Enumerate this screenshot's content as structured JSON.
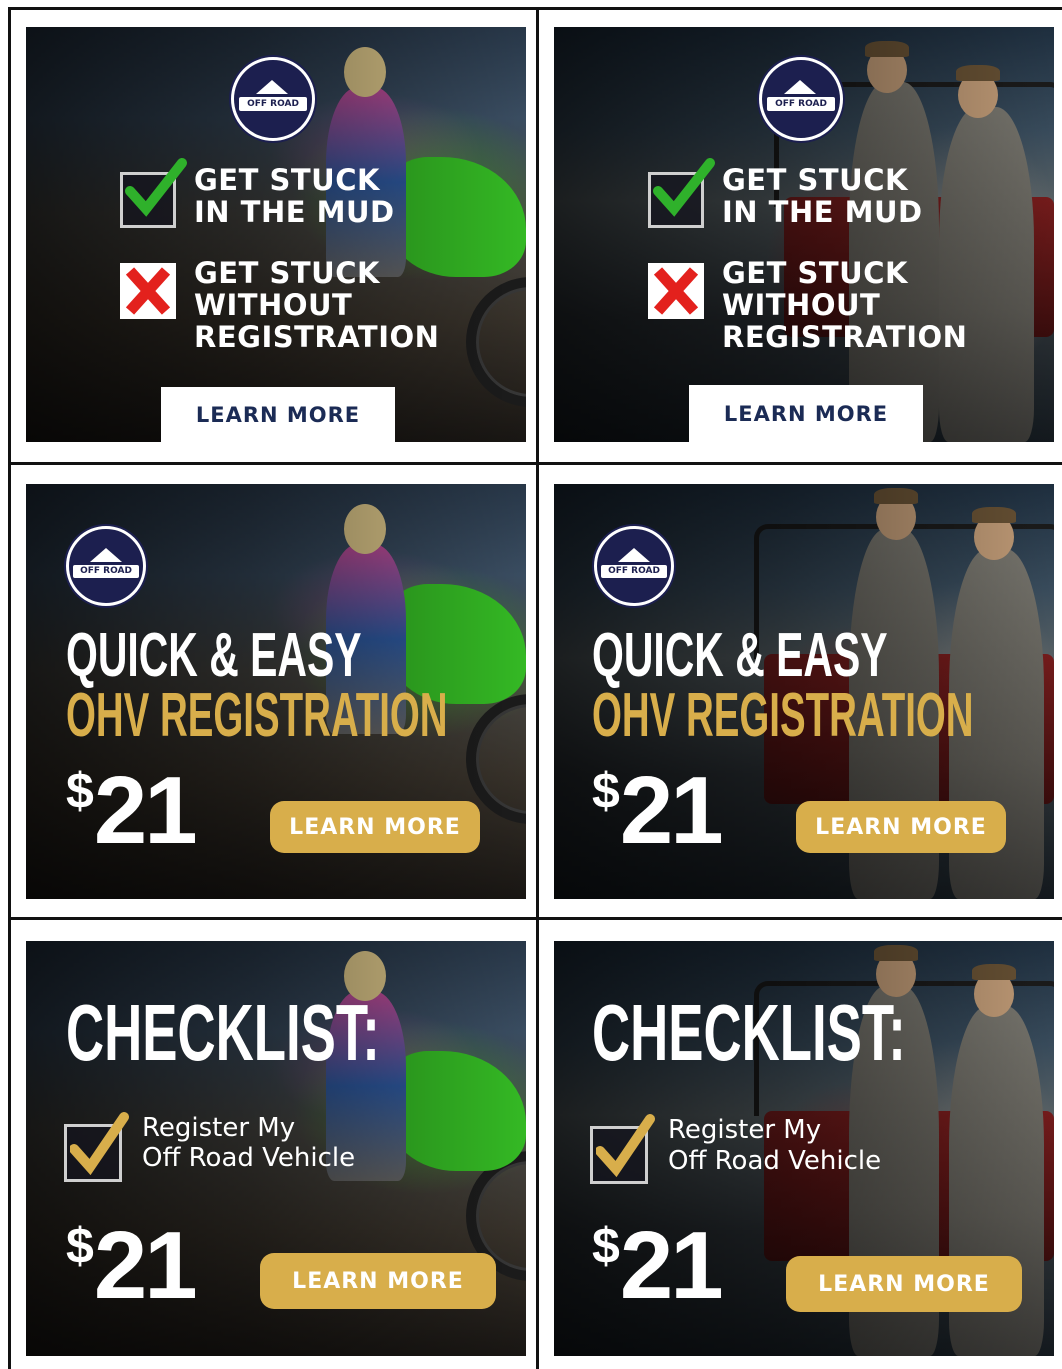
{
  "colors": {
    "gold": "#d8ae4b",
    "navy": "#1b2b55",
    "check_green": "#2fb12b",
    "cross_red": "#e3211d"
  },
  "logo": {
    "text": "OFF ROAD"
  },
  "row1": {
    "check_line1": "GET STUCK",
    "check_line2": "IN THE MUD",
    "cross_line1": "GET STUCK",
    "cross_line2": "WITHOUT",
    "cross_line3": "REGISTRATION",
    "button": "LEARN MORE"
  },
  "row2": {
    "headline1": "QUICK & EASY",
    "headline2": "OHV REGISTRATION",
    "dollar": "$",
    "price": "21",
    "button": "LEARN MORE"
  },
  "row3": {
    "headline": "CHECKLIST:",
    "item_line1": "Register My",
    "item_line2": "Off Road Vehicle",
    "dollar": "$",
    "price": "21",
    "button": "LEARN MORE"
  },
  "icons": [
    "green-check-icon",
    "red-x-icon",
    "gold-check-icon",
    "logo-badge-icon"
  ]
}
